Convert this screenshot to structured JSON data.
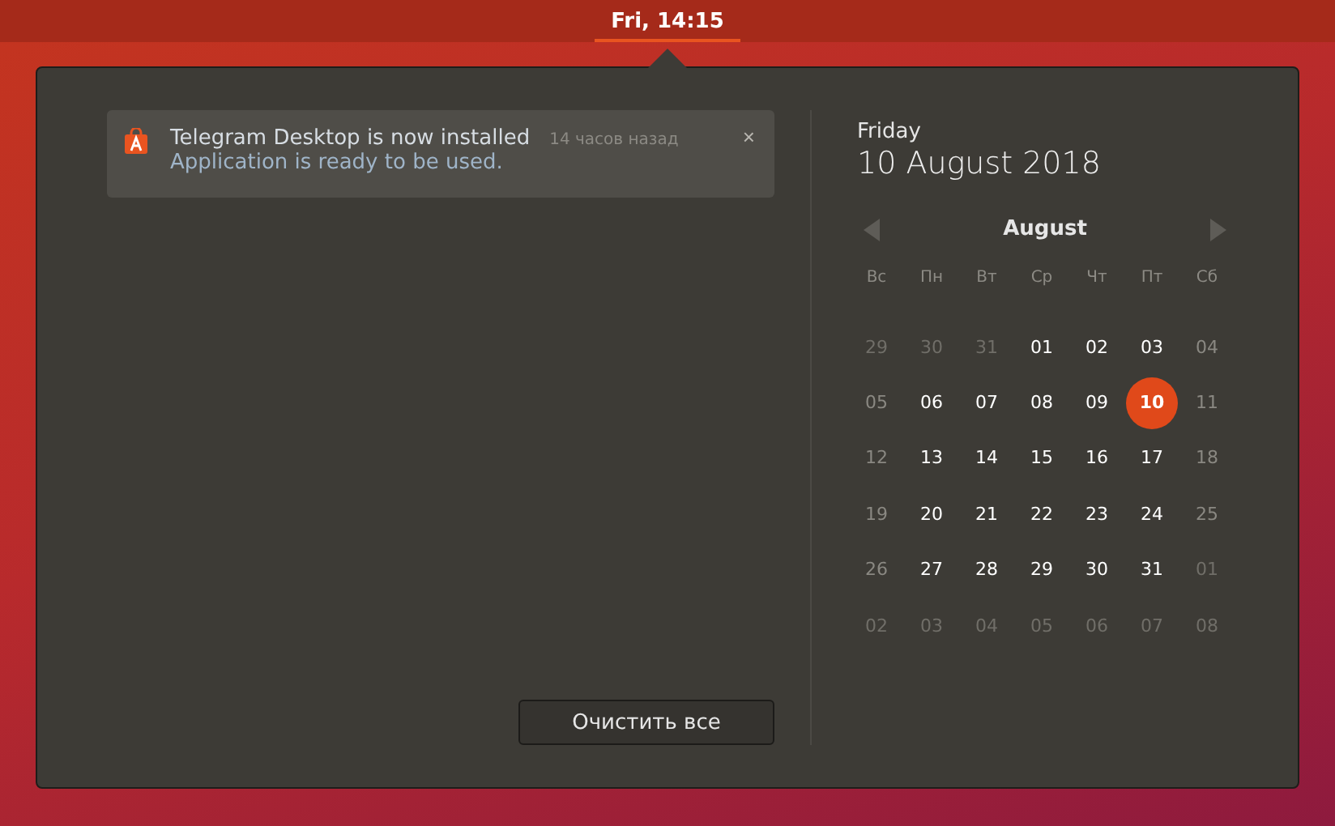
{
  "top_bar": {
    "clock": "Fri, 14:15"
  },
  "notifications": [
    {
      "title": "Telegram Desktop is now installed",
      "time": "14 часов назад",
      "body": "Application is ready to be used.",
      "close": "×"
    }
  ],
  "clear_button": "Очистить все",
  "date_header": {
    "weekday": "Friday",
    "date": "10 August 2018"
  },
  "calendar": {
    "month": "August",
    "weekdays": [
      "Вс",
      "Пн",
      "Вт",
      "Ср",
      "Чт",
      "Пт",
      "Сб"
    ],
    "days": [
      {
        "label": "29",
        "kind": "outside",
        "selected": false
      },
      {
        "label": "30",
        "kind": "outside",
        "selected": false
      },
      {
        "label": "31",
        "kind": "outside",
        "selected": false
      },
      {
        "label": "01",
        "kind": "weekday",
        "selected": false
      },
      {
        "label": "02",
        "kind": "weekday",
        "selected": false
      },
      {
        "label": "03",
        "kind": "weekday",
        "selected": false
      },
      {
        "label": "04",
        "kind": "weekend",
        "selected": false
      },
      {
        "label": "05",
        "kind": "weekend",
        "selected": false
      },
      {
        "label": "06",
        "kind": "weekday",
        "selected": false
      },
      {
        "label": "07",
        "kind": "weekday",
        "selected": false
      },
      {
        "label": "08",
        "kind": "weekday",
        "selected": false
      },
      {
        "label": "09",
        "kind": "weekday",
        "selected": false
      },
      {
        "label": "10",
        "kind": "weekday",
        "selected": true
      },
      {
        "label": "11",
        "kind": "weekend",
        "selected": false
      },
      {
        "label": "12",
        "kind": "weekend",
        "selected": false
      },
      {
        "label": "13",
        "kind": "weekday",
        "selected": false
      },
      {
        "label": "14",
        "kind": "weekday",
        "selected": false
      },
      {
        "label": "15",
        "kind": "weekday",
        "selected": false
      },
      {
        "label": "16",
        "kind": "weekday",
        "selected": false
      },
      {
        "label": "17",
        "kind": "weekday",
        "selected": false
      },
      {
        "label": "18",
        "kind": "weekend",
        "selected": false
      },
      {
        "label": "19",
        "kind": "weekend",
        "selected": false
      },
      {
        "label": "20",
        "kind": "weekday",
        "selected": false
      },
      {
        "label": "21",
        "kind": "weekday",
        "selected": false
      },
      {
        "label": "22",
        "kind": "weekday",
        "selected": false
      },
      {
        "label": "23",
        "kind": "weekday",
        "selected": false
      },
      {
        "label": "24",
        "kind": "weekday",
        "selected": false
      },
      {
        "label": "25",
        "kind": "weekend",
        "selected": false
      },
      {
        "label": "26",
        "kind": "weekend",
        "selected": false
      },
      {
        "label": "27",
        "kind": "weekday",
        "selected": false
      },
      {
        "label": "28",
        "kind": "weekday",
        "selected": false
      },
      {
        "label": "29",
        "kind": "weekday",
        "selected": false
      },
      {
        "label": "30",
        "kind": "weekday",
        "selected": false
      },
      {
        "label": "31",
        "kind": "weekday",
        "selected": false
      },
      {
        "label": "01",
        "kind": "outside",
        "selected": false
      },
      {
        "label": "02",
        "kind": "outside",
        "selected": false
      },
      {
        "label": "03",
        "kind": "outside",
        "selected": false
      },
      {
        "label": "04",
        "kind": "outside",
        "selected": false
      },
      {
        "label": "05",
        "kind": "outside",
        "selected": false
      },
      {
        "label": "06",
        "kind": "outside",
        "selected": false
      },
      {
        "label": "07",
        "kind": "outside",
        "selected": false
      },
      {
        "label": "08",
        "kind": "outside",
        "selected": false
      }
    ]
  }
}
